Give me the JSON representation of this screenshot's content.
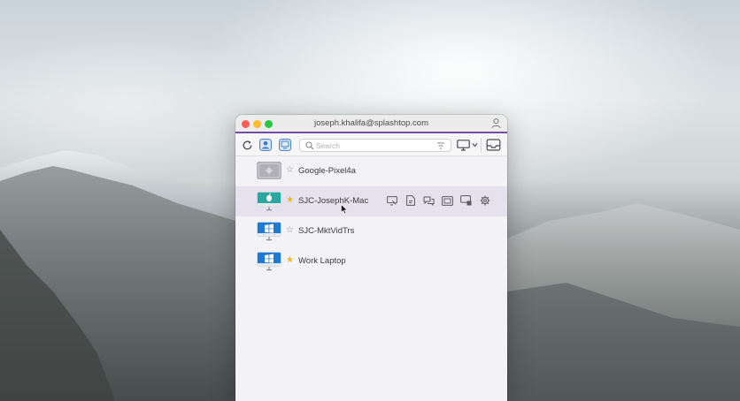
{
  "window": {
    "title": "joseph.khalifa@splashtop.com"
  },
  "toolbar": {
    "search_placeholder": "Search"
  },
  "computers": [
    {
      "name": "Google-Pixel4a",
      "type": "android",
      "favorite": false,
      "selected": false
    },
    {
      "name": "SJC-JosephK-Mac",
      "type": "mac",
      "favorite": true,
      "selected": true
    },
    {
      "name": "SJC-MktVidTrs",
      "type": "windows",
      "favorite": false,
      "selected": false
    },
    {
      "name": "Work Laptop",
      "type": "windows",
      "favorite": true,
      "selected": false
    }
  ],
  "row_actions": [
    "remote-view-icon",
    "file-transfer-icon",
    "chat-icon",
    "remote-print-icon",
    "multi-screen-icon",
    "settings-gear-icon"
  ],
  "colors": {
    "accent": "#6f4ea2",
    "selected_row": "#e5e2ee",
    "favorite_star": "#e2b92a"
  }
}
